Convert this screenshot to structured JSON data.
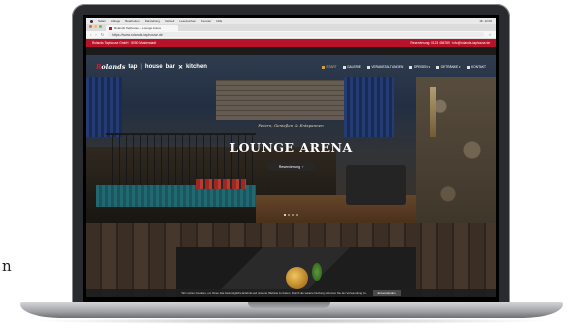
{
  "side_text": "n",
  "mac_menubar": {
    "items": [
      "Safari",
      "Ablage",
      "Bearbeiten",
      "Darstellung",
      "Verlauf",
      "Lesezeichen",
      "Fenster",
      "Hilfe"
    ],
    "clock": "Mi. 12:00"
  },
  "browser": {
    "tab_title": "Rolands Taphouse – Lounge Arena",
    "url": "https://www.rolands-taphouse.de"
  },
  "topbar": {
    "left": "Rolands Taphouse GmbH · 8050 Musterstadt",
    "right": "Reservierung: 0123 456789 · info@rolands-taphouse.de"
  },
  "logo": {
    "brand_prefix": "R",
    "brand_rest": "olands",
    "part1": "tap",
    "part2": "house",
    "part3": "bar",
    "x": "✕",
    "part4": "kitchen"
  },
  "menu": {
    "items": [
      {
        "label": "START",
        "active": true
      },
      {
        "label": "GALERIE",
        "active": false
      },
      {
        "label": "VERANSTALTUNGEN",
        "active": false
      },
      {
        "label": "SPEISEN ▾",
        "active": false
      },
      {
        "label": "GETRÄNKE ▾",
        "active": false
      },
      {
        "label": "KONTAKT",
        "active": false
      }
    ]
  },
  "hero": {
    "subtitle": "Feiern, Genießen & Entspannen",
    "title": "LOUNGE ARENA",
    "button": "Reservierung"
  },
  "cookie": {
    "text": "Wir nutzen Cookies, um Ihnen das bestmögliche Erlebnis auf unserer Website zu bieten. Durch die weitere Nutzung stimmen Sie der Verwendung zu.",
    "button": "Einverstanden"
  },
  "colors": {
    "brand_red": "#b8112a",
    "accent_gold": "#e8b64e"
  }
}
